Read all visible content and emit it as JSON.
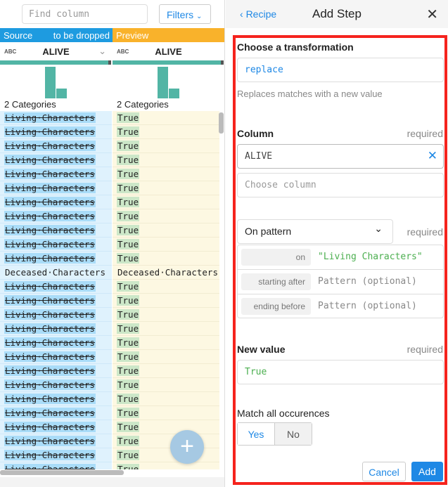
{
  "toolbar": {
    "find_placeholder": "Find column",
    "filters_label": "Filters"
  },
  "grid": {
    "source_header": "Source",
    "source_note": "to be dropped",
    "preview_header": "Preview",
    "source_column": {
      "type": "ABC",
      "name": "ALIVE",
      "categories": "2 Categories"
    },
    "preview_column": {
      "type": "ABC",
      "name": "ALIVE",
      "categories": "2 Categories"
    },
    "histogram_colors": "#52b5a5",
    "rows": [
      {
        "source": "Living·Characters",
        "preview": "True",
        "changed": true
      },
      {
        "source": "Living·Characters",
        "preview": "True",
        "changed": true
      },
      {
        "source": "Living·Characters",
        "preview": "True",
        "changed": true
      },
      {
        "source": "Living·Characters",
        "preview": "True",
        "changed": true
      },
      {
        "source": "Living·Characters",
        "preview": "True",
        "changed": true
      },
      {
        "source": "Living·Characters",
        "preview": "True",
        "changed": true
      },
      {
        "source": "Living·Characters",
        "preview": "True",
        "changed": true
      },
      {
        "source": "Living·Characters",
        "preview": "True",
        "changed": true
      },
      {
        "source": "Living·Characters",
        "preview": "True",
        "changed": true
      },
      {
        "source": "Living·Characters",
        "preview": "True",
        "changed": true
      },
      {
        "source": "Living·Characters",
        "preview": "True",
        "changed": true
      },
      {
        "source": "Deceased·Characters",
        "preview": "Deceased·Characters",
        "changed": false
      },
      {
        "source": "Living·Characters",
        "preview": "True",
        "changed": true
      },
      {
        "source": "Living·Characters",
        "preview": "True",
        "changed": true
      },
      {
        "source": "Living·Characters",
        "preview": "True",
        "changed": true
      },
      {
        "source": "Living·Characters",
        "preview": "True",
        "changed": true
      },
      {
        "source": "Living·Characters",
        "preview": "True",
        "changed": true
      },
      {
        "source": "Living·Characters",
        "preview": "True",
        "changed": true
      },
      {
        "source": "Living·Characters",
        "preview": "True",
        "changed": true
      },
      {
        "source": "Living·Characters",
        "preview": "True",
        "changed": true
      },
      {
        "source": "Living·Characters",
        "preview": "True",
        "changed": true
      },
      {
        "source": "Living·Characters",
        "preview": "True",
        "changed": true
      },
      {
        "source": "Living·Characters",
        "preview": "True",
        "changed": true
      },
      {
        "source": "Living·Characters",
        "preview": "True",
        "changed": true
      },
      {
        "source": "Living·Characters",
        "preview": "True",
        "changed": true
      },
      {
        "source": "Living·Characters",
        "preview": "True",
        "changed": true
      }
    ],
    "fab_label": "+"
  },
  "panel": {
    "back_label": "Recipe",
    "title": "Add Step",
    "close_icon": "close-icon",
    "transformation_label": "Choose a transformation",
    "transformation_value": "replace",
    "transformation_desc": "Replaces matches with a new value",
    "column_label": "Column",
    "required": "required",
    "column_value": "ALIVE",
    "column_placeholder": "Choose column",
    "mode_value": "On pattern",
    "pattern": [
      {
        "key": "on",
        "value": "\"Living Characters\""
      },
      {
        "key": "starting after",
        "placeholder": "Pattern (optional)"
      },
      {
        "key": "ending before",
        "placeholder": "Pattern (optional)"
      }
    ],
    "new_value_label": "New value",
    "new_value": "True",
    "match_all_label": "Match all occurences",
    "yes": "Yes",
    "no": "No",
    "selected": "Yes",
    "cancel": "Cancel",
    "add": "Add",
    "accent": "#1e88e5",
    "highlight": "#f5231d"
  }
}
